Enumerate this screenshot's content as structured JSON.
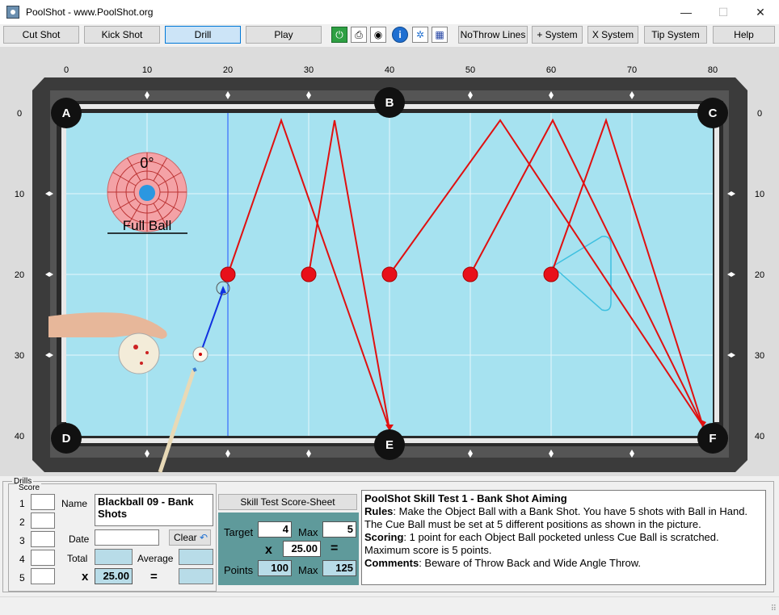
{
  "window": {
    "title": "PoolShot - www.PoolShot.org",
    "minimize": "—",
    "maximize": "☐",
    "close": "✕"
  },
  "toolbar": {
    "cut_shot": "Cut Shot",
    "kick_shot": "Kick Shot",
    "drill": "Drill",
    "play": "Play",
    "no_throw": "NoThrow Lines",
    "plus_system": "+ System",
    "x_system": "X System",
    "tip_system": "Tip System",
    "help": "Help"
  },
  "icons": [
    "power-icon",
    "print-icon",
    "camera-icon",
    "info-icon",
    "settings-icon",
    "calculator-icon"
  ],
  "table": {
    "top_ruler": [
      "0",
      "10",
      "20",
      "30",
      "40",
      "50",
      "60",
      "70",
      "80"
    ],
    "side_ruler": [
      "0",
      "10",
      "20",
      "30",
      "40"
    ],
    "pockets": [
      "A",
      "B",
      "C",
      "D",
      "E",
      "F"
    ],
    "aim_angle": "0°",
    "aim_label": "Full Ball",
    "rail_color": "#3a3a3a",
    "cloth_color": "#a6e2f0",
    "line_color": "#e01010"
  },
  "drills": {
    "group_label": "Drills",
    "score_label": "Score",
    "rows": [
      "1",
      "2",
      "3",
      "4",
      "5"
    ],
    "name_label": "Name",
    "name_value": "Blackball 09 - Bank Shots",
    "date_label": "Date",
    "date_value": "",
    "clear_label": "Clear",
    "total_label": "Total",
    "average_label": "Average",
    "x_label": "x",
    "multiplier": "25.00",
    "equals_label": "="
  },
  "skill_test": {
    "sheet_button": "Skill Test Score-Sheet",
    "target_label": "Target",
    "target_value": "4",
    "max_label": "Max",
    "max_value": "5",
    "x_label": "x",
    "multiplier": "25.00",
    "equals": "=",
    "points_label": "Points",
    "points_value": "100",
    "points_max_label": "Max",
    "points_max_value": "125"
  },
  "rules": {
    "title": "PoolShot Skill Test 1 - Bank Shot Aiming",
    "rules_label": "Rules",
    "rules_text": ": Make the Object Ball with a Bank Shot. You have 5 shots with Ball in Hand. The Cue Ball must be set at 5 different positions as shown in the picture.",
    "scoring_label": "Scoring",
    "scoring_text": ": 1 point for each Object Ball pocketed unless Cue Ball is scratched. Maximum score is 5 points.",
    "comments_label": "Comments",
    "comments_text": ": Beware of Throw Back and Wide Angle Throw."
  }
}
